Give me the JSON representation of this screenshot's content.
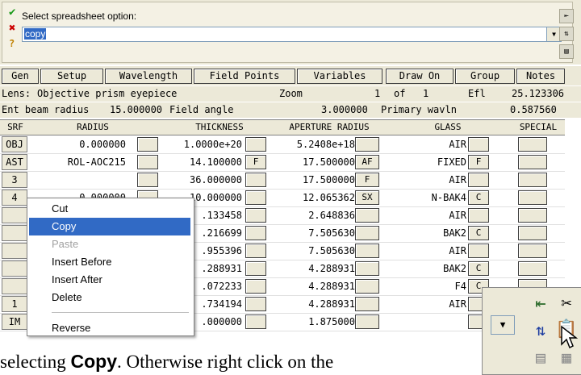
{
  "command": {
    "prompt": "Select spreadsheet option:",
    "value": "copy",
    "accept_icon": "check-icon",
    "cancel_icon": "x-icon",
    "help_icon": "question-icon"
  },
  "tabs": [
    "Gen",
    "Setup",
    "Wavelength",
    "Field Points",
    "Variables",
    "Draw On",
    "Group",
    "Notes"
  ],
  "info1": {
    "lens_label": "Lens:",
    "lens_name": "Objective prism eyepiece",
    "zoom_label": "Zoom",
    "zoom_value": "1",
    "of_label": "of",
    "zoom_total": "1",
    "efl_label": "Efl",
    "efl_value": "25.123306"
  },
  "info2": {
    "ebr_label": "Ent beam radius",
    "ebr_value": "15.000000",
    "fa_label": "Field angle",
    "fa_value": "3.000000",
    "pw_label": "Primary wavln",
    "pw_value": "0.587560"
  },
  "columns": [
    "SRF",
    "RADIUS",
    "THICKNESS",
    "APERTURE RADIUS",
    "GLASS",
    "SPECIAL"
  ],
  "rows": [
    {
      "srf": "OBJ",
      "radius": "0.000000",
      "thickness": "1.0000e+20",
      "thick_flag": "",
      "aperture": "5.2408e+18",
      "ap_flag": "",
      "glass": "AIR",
      "glass_flag": ""
    },
    {
      "srf": "AST",
      "radius": "ROL-AOC215",
      "thickness": "14.100000",
      "thick_flag": "F",
      "aperture": "17.500000",
      "ap_flag": "AF",
      "glass": "FIXED",
      "glass_flag": "F"
    },
    {
      "srf": "3",
      "radius": "",
      "thickness": "36.000000",
      "thick_flag": "",
      "aperture": "17.500000",
      "ap_flag": "F",
      "glass": "AIR",
      "glass_flag": ""
    },
    {
      "srf": "4",
      "radius": "0.000000",
      "thickness": "10.000000",
      "thick_flag": "",
      "aperture": "12.065362",
      "ap_flag": "SX",
      "glass": "N-BAK4",
      "glass_flag": "C"
    },
    {
      "srf": "",
      "radius": "",
      "thickness": ".133458",
      "thick_flag": "",
      "aperture": "2.648836",
      "ap_flag": "",
      "glass": "AIR",
      "glass_flag": ""
    },
    {
      "srf": "",
      "radius": "",
      "thickness": ".216699",
      "thick_flag": "",
      "aperture": "7.505630",
      "ap_flag": "",
      "glass": "BAK2",
      "glass_flag": "C"
    },
    {
      "srf": "",
      "radius": "",
      "thickness": ".955396",
      "thick_flag": "",
      "aperture": "7.505630",
      "ap_flag": "",
      "glass": "AIR",
      "glass_flag": ""
    },
    {
      "srf": "",
      "radius": "",
      "thickness": ".288931",
      "thick_flag": "",
      "aperture": "4.288931",
      "ap_flag": "",
      "glass": "BAK2",
      "glass_flag": "C"
    },
    {
      "srf": "",
      "radius": "",
      "thickness": ".072233",
      "thick_flag": "",
      "aperture": "4.288931",
      "ap_flag": "",
      "glass": "F4",
      "glass_flag": "C"
    },
    {
      "srf": "1",
      "radius": "",
      "thickness": ".734194",
      "thick_flag": "",
      "aperture": "4.288931",
      "ap_flag": "",
      "glass": "AIR",
      "glass_flag": ""
    },
    {
      "srf": "IM",
      "radius": "",
      "thickness": ".000000",
      "thick_flag": "",
      "aperture": "1.875000",
      "ap_flag": "",
      "glass": "",
      "glass_flag": ""
    }
  ],
  "context_menu": {
    "items": [
      "Cut",
      "Copy",
      "Paste",
      "Insert Before",
      "Insert After",
      "Delete",
      "Reverse"
    ],
    "selected": "Copy",
    "disabled": [
      "Paste"
    ]
  },
  "footer": {
    "pre": "selecting ",
    "bold": "Copy",
    "post": ". Otherwise right click on the"
  },
  "colors": {
    "selection": "#316ac5",
    "face": "#ece9d8"
  }
}
